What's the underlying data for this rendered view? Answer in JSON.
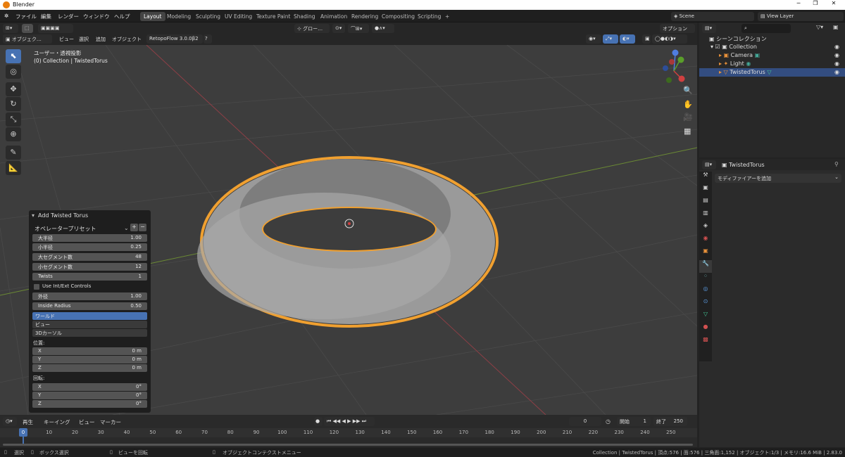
{
  "app": {
    "title": "Blender"
  },
  "menu": [
    "ファイル",
    "編集",
    "レンダー",
    "ウィンドウ",
    "ヘルプ"
  ],
  "workspaces": [
    "Layout",
    "Modeling",
    "Sculpting",
    "UV Editing",
    "Texture Paint",
    "Shading",
    "Animation",
    "Rendering",
    "Compositing",
    "Scripting"
  ],
  "scene": {
    "name": "Scene",
    "view_layer": "View Layer"
  },
  "viewport_header": {
    "mode": "オブジェク…",
    "menus": [
      "ビュー",
      "選択",
      "追加",
      "オブジェクト"
    ],
    "addon": "RetopoFlow 3.0.0β2",
    "transform_orientation": "グロー…",
    "options": "オプション"
  },
  "overlay_text": {
    "view": "ユーザー・透視投影",
    "collection": "(0) Collection | TwistedTorus"
  },
  "operator": {
    "title": "Add Twisted Torus",
    "preset_label": "オペレータープリセット",
    "fields": [
      {
        "label": "大半径",
        "value": "1.00"
      },
      {
        "label": "小半径",
        "value": "0.25"
      },
      {
        "label": "大セグメント数",
        "value": "48"
      },
      {
        "label": "小セグメント数",
        "value": "12"
      },
      {
        "label": "Twists",
        "value": "1"
      }
    ],
    "checkbox": "Use Int/Ext Controls",
    "fields2": [
      {
        "label": "外径",
        "value": "1.00"
      },
      {
        "label": "Inside Radius",
        "value": "0.50"
      }
    ],
    "align_options": [
      "ワールド",
      "ビュー",
      "3Dカーソル"
    ],
    "align_selected": "ワールド",
    "location_label": "位置:",
    "location": [
      {
        "axis": "X",
        "value": "0 m"
      },
      {
        "axis": "Y",
        "value": "0 m"
      },
      {
        "axis": "Z",
        "value": "0 m"
      }
    ],
    "rotation_label": "回転:",
    "rotation": [
      {
        "axis": "X",
        "value": "0°"
      },
      {
        "axis": "Y",
        "value": "0°"
      },
      {
        "axis": "Z",
        "value": "0°"
      }
    ]
  },
  "outliner": {
    "root": "シーンコレクション",
    "items": [
      {
        "label": "Collection"
      },
      {
        "label": "Camera"
      },
      {
        "label": "Light"
      },
      {
        "label": "TwistedTorus"
      }
    ]
  },
  "properties": {
    "object_name": "TwistedTorus",
    "add_modifier": "モディファイアーを追加"
  },
  "timeline": {
    "menus": [
      "再生",
      "キーイング",
      "ビュー",
      "マーカー"
    ],
    "current_frame": "0",
    "start_label": "開始",
    "start": "1",
    "end_label": "終了",
    "end": "250",
    "ruler": [
      "0",
      "10",
      "20",
      "30",
      "40",
      "50",
      "60",
      "70",
      "80",
      "90",
      "100",
      "110",
      "120",
      "130",
      "140",
      "150",
      "160",
      "170",
      "180",
      "190",
      "200",
      "210",
      "220",
      "230",
      "240",
      "250"
    ]
  },
  "status": {
    "select": "選択",
    "box_select": "ボックス選択",
    "rotate_view": "ビューを回転",
    "context_menu": "オブジェクトコンテクストメニュー",
    "stats": "Collection | TwistedTorus | 頂点:576 | 面:576 | 三角面:1,152 | オブジェクト:1/3 | メモリ:16.6 MiB | 2.83.0"
  }
}
